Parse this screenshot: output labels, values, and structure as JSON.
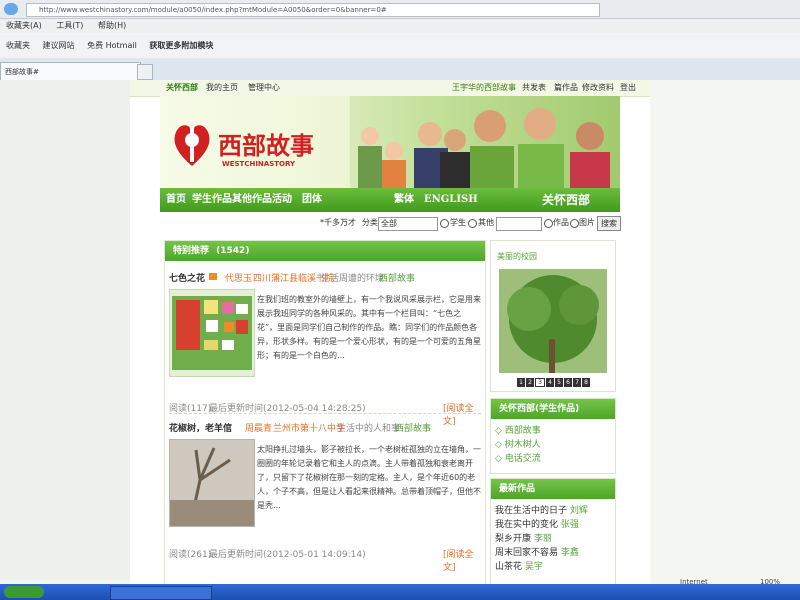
{
  "browser": {
    "address_url": "http://www.westchinastory.com/module/a0050/index.php?mtModule=A0050&order=0&banner=0#",
    "menu": [
      "收藏夹(A)",
      "工具(T)",
      "帮助(H)"
    ],
    "favorites": [
      "收藏夹",
      "建议网站",
      "免费 Hotmail",
      "获取更多附加模块"
    ],
    "tab_title": "西部故事#"
  },
  "site": {
    "brand": "关怀西部",
    "topnav": [
      "我的主页",
      "管理中心"
    ],
    "topnav_right": [
      "王宇华的西部故事",
      "共发表",
      "篇作品",
      "修改资料",
      "登出"
    ],
    "logo_text": "西部故事",
    "logo_sub": "WESTCHINASTORY",
    "mainnav": [
      "首页",
      "学生作品",
      "其他作品",
      "活动",
      "团体"
    ],
    "lang": [
      "繁体",
      "ENGLISH"
    ],
    "slogan": "关怀西部",
    "search": {
      "hint": "*千多万才",
      "category_label": "分类",
      "category_value": "全部",
      "radio_student": "学生",
      "radio_other": "其他",
      "radio_work": "作品",
      "radio_image": "图片",
      "button": "搜索"
    }
  },
  "featured": {
    "title": "特别推荐",
    "count": "(1542)",
    "articles": [
      {
        "title": "七色之花",
        "author": "代思玉",
        "school": "四川蒲江县临溪书院",
        "category": "生活周遭的环境",
        "tag": "西部故事",
        "excerpt": "在我们班的教室外的墙壁上，有一个我说风采展示栏，它是用来展示我班同学的各种风采的。其中有一个栏目叫：“七色之花”，里面是同学们自己制作的作品。瞧：同学们的作品颜色各异，形状多样。有的是一个爱心形状，有的是一个可爱的五角星形；有的是一个白色的…",
        "views": "阅读(117)",
        "updated": "最后更新时间(2012-05-04 14:28:25)",
        "readmore": "[阅读全文]"
      },
      {
        "title": "花椒树，老羊倌",
        "author": "周晨青",
        "school": "兰州市第十八中学",
        "category": "生活中的人和事",
        "tag": "西部故事",
        "excerpt": "太阳挣扎过墙头，影子被拉长，一个老树桩孤独的立在墙角，一圈圈的年轮记录着它和主人的点滴。主人带着孤独和衰老离开了，只留下了花椒树在那一刻的定格。主人，是个年近60的老人，个子不高，但是让人看起来很精神。总带着顶帽子，但他不是秃…",
        "views": "阅读(261)",
        "updated": "最后更新时间(2012-05-01 14:09:14)",
        "readmore": "[阅读全文]"
      }
    ]
  },
  "sidebar": {
    "photo_title": "美丽的校园",
    "pager": [
      "1",
      "2",
      "3",
      "4",
      "5",
      "6",
      "7",
      "8"
    ],
    "pager_active": "3",
    "student_box": {
      "title": "关怀西部(学生作品)",
      "items": [
        "西部故事",
        "树木树人",
        "电话交流"
      ]
    },
    "latest_box": {
      "title": "最新作品",
      "items": [
        {
          "title": "我在生活中的日子",
          "author": "刘辉"
        },
        {
          "title": "我在实中的变化",
          "author": "张强"
        },
        {
          "title": "梨乡开康",
          "author": "李丽"
        },
        {
          "title": "周末回家不容易",
          "author": "李鑫"
        },
        {
          "title": "山茶花",
          "author": "吴宇"
        }
      ]
    }
  },
  "status": {
    "internet": "Internet",
    "zoom": "100%"
  },
  "colors": {
    "brand_green": "#4ea52b",
    "accent_orange": "#e66c24",
    "logo_red": "#d21f1f"
  }
}
